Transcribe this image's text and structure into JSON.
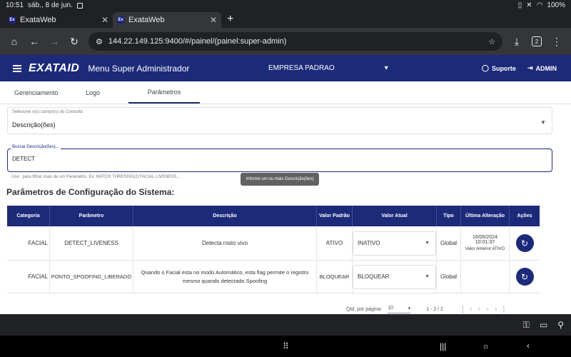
{
  "status": {
    "time": "10:51",
    "date": "sáb., 8 de jun.",
    "battery": "100%"
  },
  "tabs": [
    {
      "title": "ExataWeb",
      "favicon": "Ex"
    },
    {
      "title": "ExataWeb",
      "favicon": "Ex"
    }
  ],
  "browser": {
    "url": "144.22.149.125:9400/#/painel/(painel:super-admin)",
    "tab_count": "2"
  },
  "appbar": {
    "logo": "EXATA",
    "logo_suffix": "ID",
    "title": "Menu Super Administrador",
    "company": "EMPRESA PADRAO",
    "support": "Suporte",
    "admin": "ADMIN"
  },
  "subtabs": [
    "Gerenciamento",
    "Logo",
    "Parâmetros"
  ],
  "filters": {
    "field1_label": "Selecione o(s) campo(s) do Consulta",
    "field1_value": "Descrição(ões)",
    "field2_label": "Buscar Descrição(ões)...",
    "field2_value": "DETECT",
    "hint": "Use ; para filtrar mais de um Parametro. Ex: MATCH THRESHOLD;FACIAL LIVENESS...",
    "tooltip": "Informe um ou mais Descrição(ões)"
  },
  "section_title": "Parâmetros de Configuração do Sistema:",
  "table": {
    "headers": [
      "Categoria",
      "Parâmetro",
      "Descrição",
      "Valor Padrão",
      "Valor Atual",
      "Tipo",
      "Última Alteração",
      "Ações"
    ],
    "rows": [
      {
        "categoria": "FACIAL",
        "parametro": "DETECT_LIVENESS",
        "descricao": "Detecta rosto vivo",
        "padrao": "ATIVO",
        "atual": "INATIVO",
        "tipo": "Global",
        "alteracao_data": "16/05/2024",
        "alteracao_hora": "10:01:37",
        "valor_anterior": "Valor Anterior:ATIVO"
      },
      {
        "categoria": "FACIAL",
        "parametro": "PONTO_SPOOFING_LIBERADO",
        "descricao": "Quando o Facial esta no modo Automático, esta flag permite o registro mesmo quando detectado Spoofing",
        "padrao": "BLOQUEAR",
        "atual": "BLOQUEAR",
        "tipo": "Global",
        "alteracao_data": "",
        "alteracao_hora": "",
        "valor_anterior": ""
      }
    ]
  },
  "pager": {
    "label": "Qtd. por página:",
    "per_page": "10",
    "range": "1 - 2 / 2"
  }
}
